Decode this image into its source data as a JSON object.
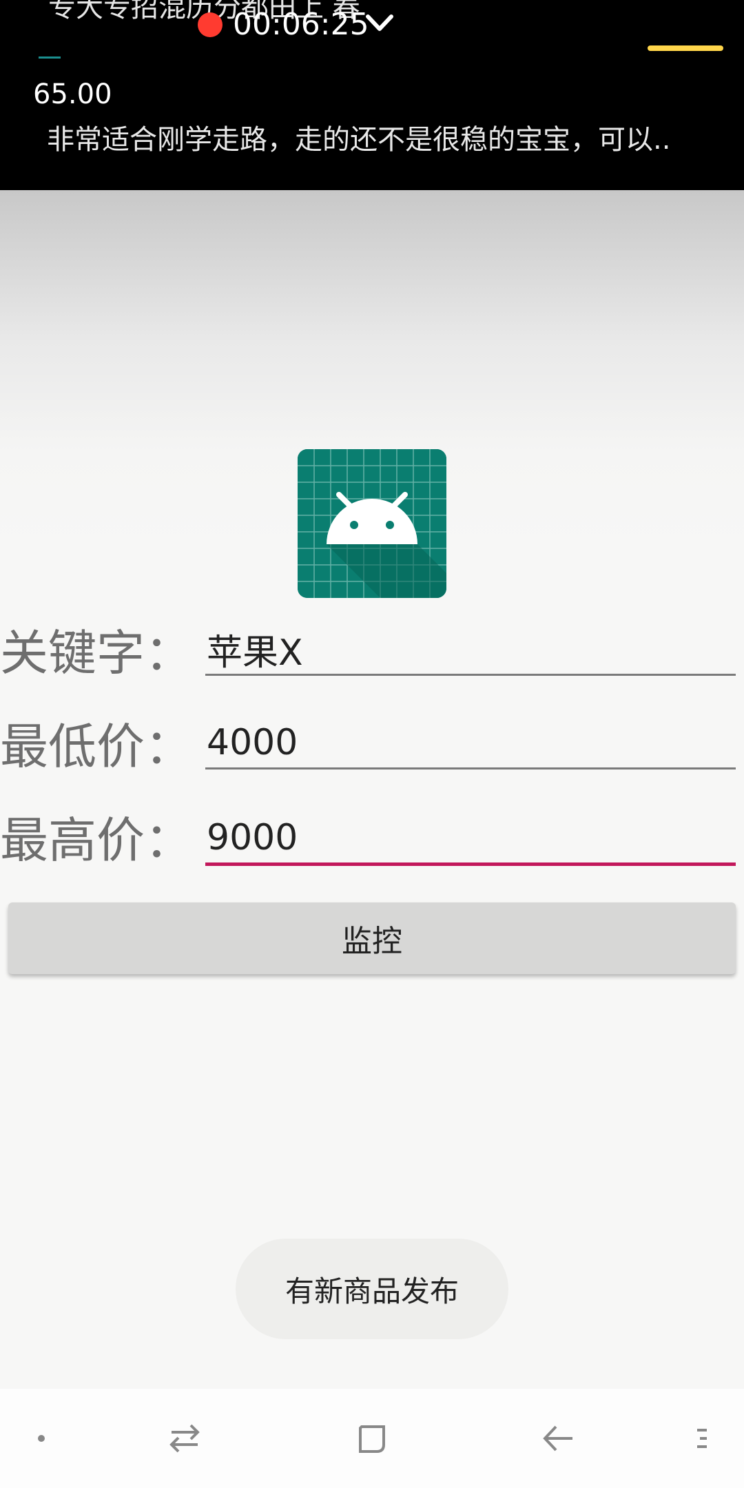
{
  "notification": {
    "cut_text": "专大专招混历分都田上 春",
    "recording_time": "00:06:25",
    "price": "65.00",
    "description": "非常适合刚学走路，走的还不是很稳的宝宝，可以.."
  },
  "form": {
    "keyword_label": "关键字：",
    "keyword_value": "苹果X",
    "min_price_label": "最低价：",
    "min_price_value": "4000",
    "max_price_label": "最高价：",
    "max_price_value": "9000",
    "monitor_button": "监控"
  },
  "toast": {
    "message": "有新商品发布"
  },
  "colors": {
    "accent_underline": "#c2185b",
    "app_icon_bg": "#0a7e70",
    "record_dot": "#ff3b30"
  },
  "icons": [
    "record-dot-icon",
    "chevron-down-icon",
    "android-app-icon",
    "nav-dot-icon",
    "switch-arrows-icon",
    "recent-apps-icon",
    "back-arrow-icon",
    "menu-lines-icon"
  ]
}
